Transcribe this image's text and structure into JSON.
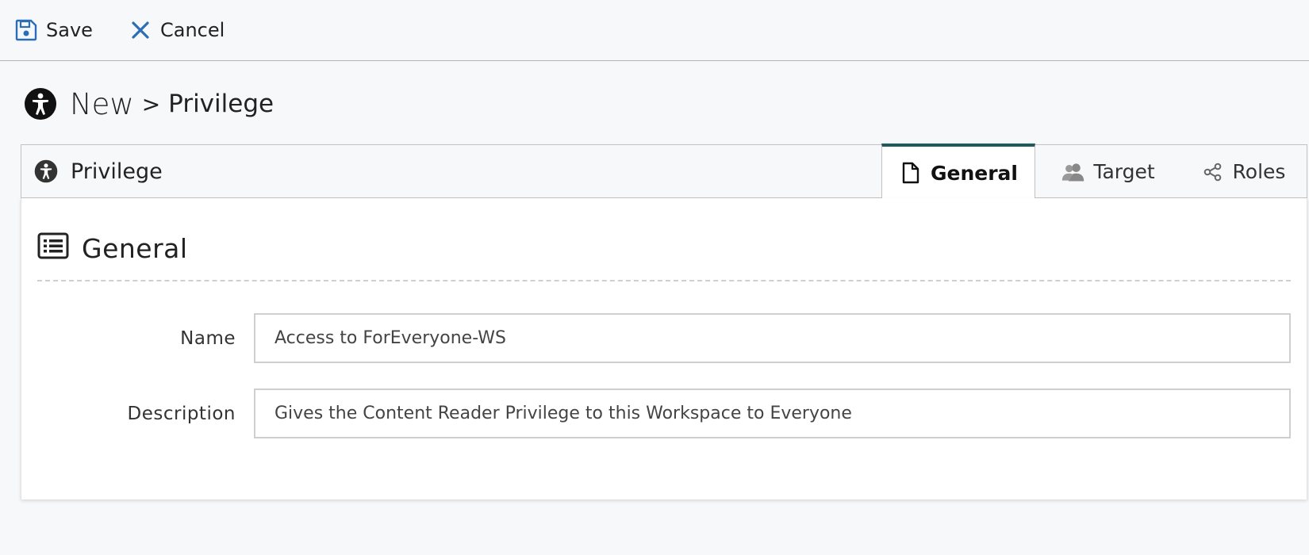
{
  "toolbar": {
    "save_label": "Save",
    "cancel_label": "Cancel"
  },
  "breadcrumb": {
    "new_label": "New",
    "separator": ">",
    "type_label": "Privilege"
  },
  "record": {
    "title": "Privilege"
  },
  "tabs": [
    {
      "label": "General",
      "icon": "document-icon",
      "active": true
    },
    {
      "label": "Target",
      "icon": "users-icon",
      "active": false
    },
    {
      "label": "Roles",
      "icon": "share-nodes-icon",
      "active": false
    }
  ],
  "section": {
    "title": "General"
  },
  "fields": {
    "name_label": "Name",
    "name_value": "Access to ForEveryone-WS",
    "description_label": "Description",
    "description_value": "Gives the Content Reader Privilege to this Workspace to Everyone"
  },
  "colors": {
    "accent": "#1d5b5e",
    "toolbar_icon": "#2a6fb5",
    "background": "#f7f8fa"
  }
}
